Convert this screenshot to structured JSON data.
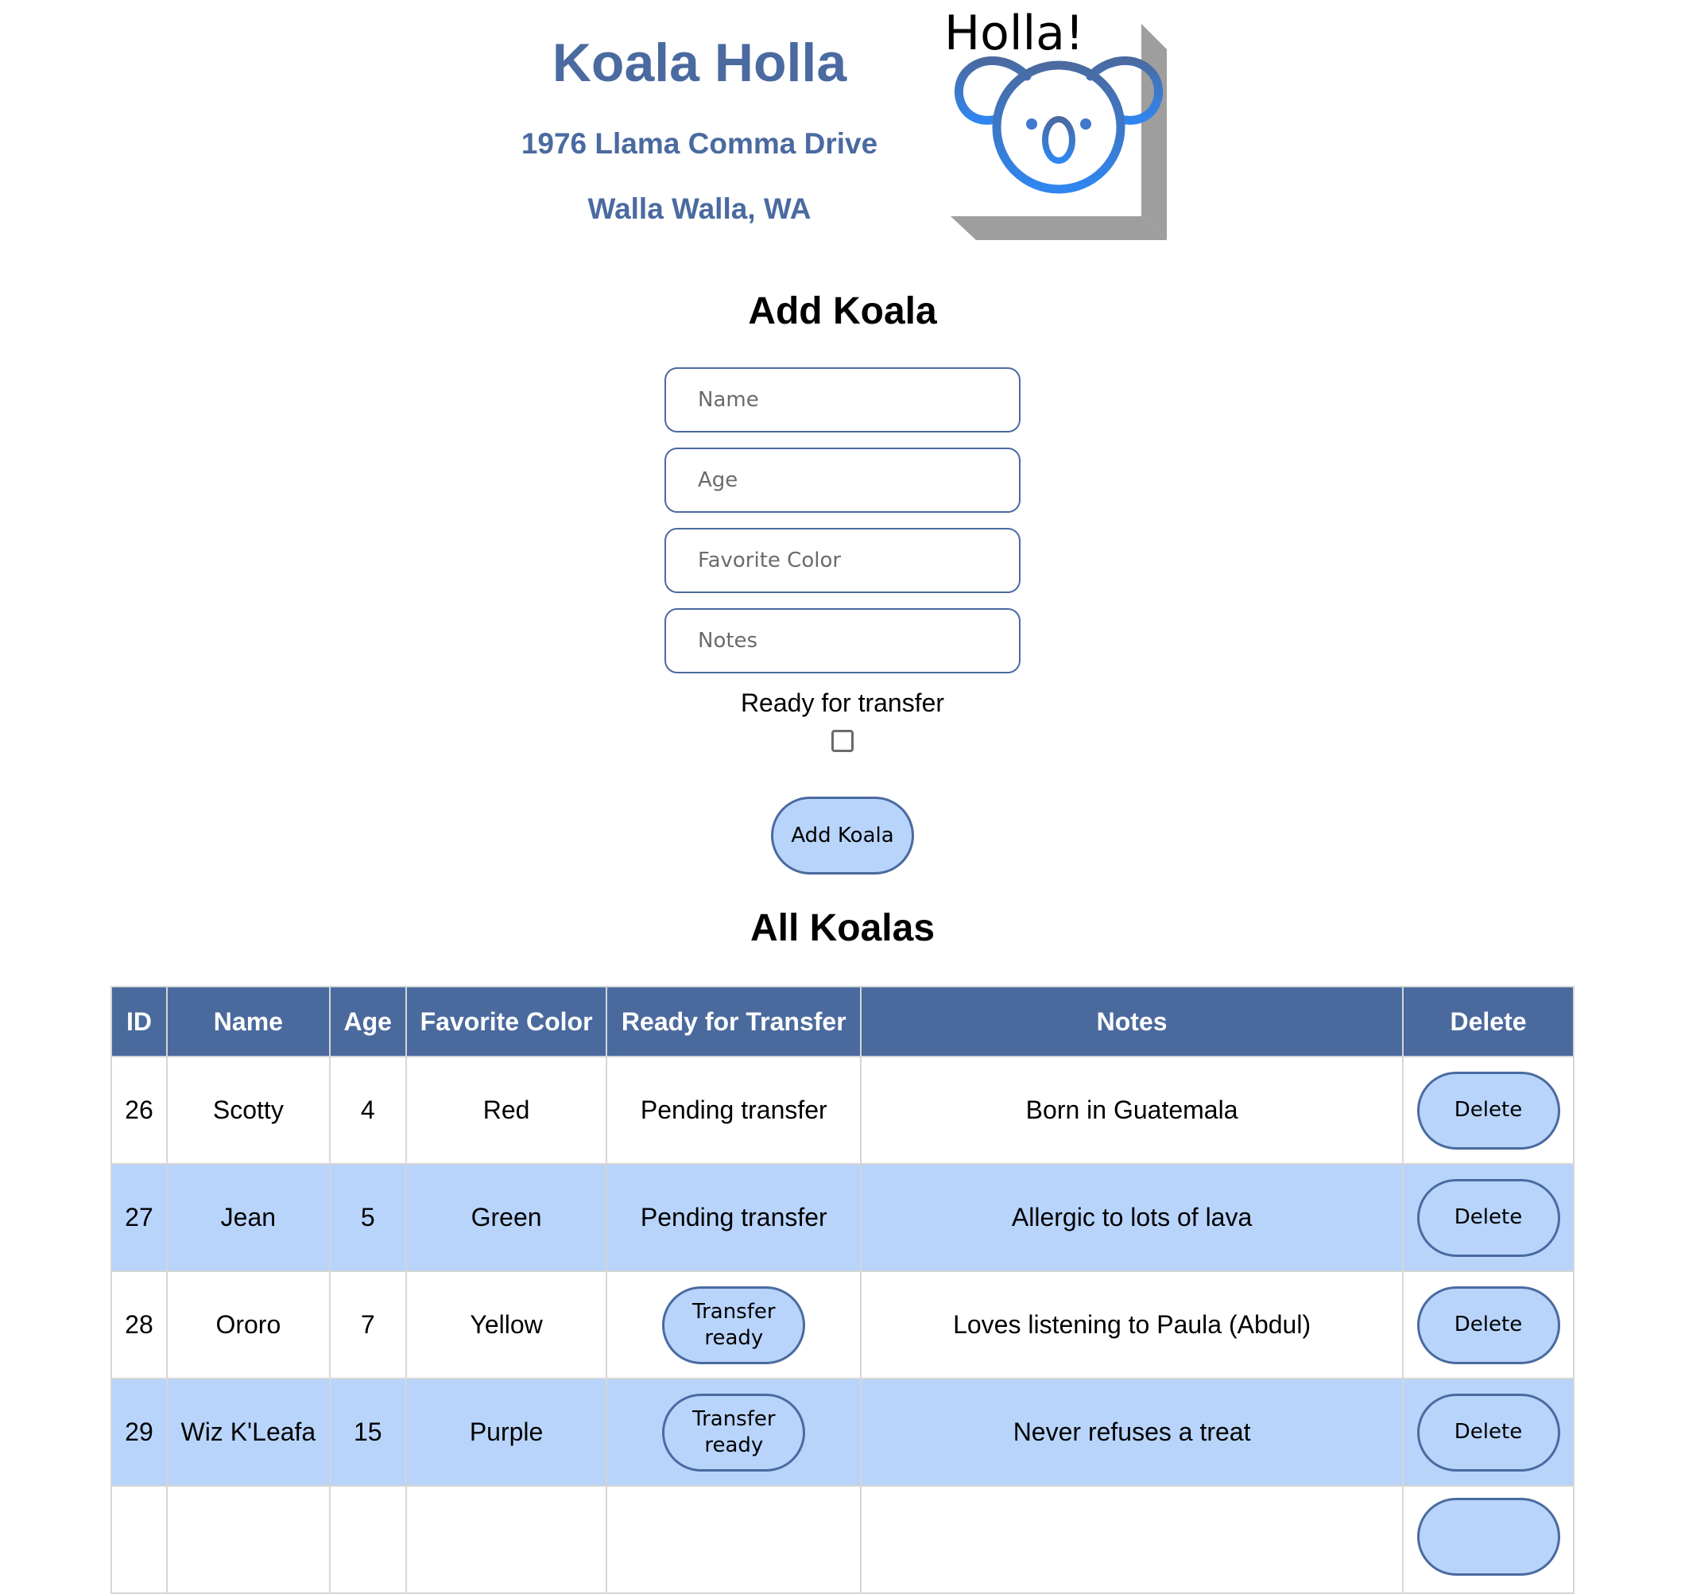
{
  "header": {
    "title": "Koala Holla",
    "address_line1": "1976 Llama Comma Drive",
    "address_line2": "Walla Walla, WA",
    "logo_text": "Holla!"
  },
  "add_form": {
    "title": "Add Koala",
    "name_placeholder": "Name",
    "age_placeholder": "Age",
    "color_placeholder": "Favorite Color",
    "notes_placeholder": "Notes",
    "ready_label": "Ready for transfer",
    "ready_checked": false,
    "submit_label": "Add Koala"
  },
  "table": {
    "title": "All Koalas",
    "columns": [
      "ID",
      "Name",
      "Age",
      "Favorite Color",
      "Ready for Transfer",
      "Notes",
      "Delete"
    ],
    "rows": [
      {
        "id": "26",
        "name": "Scotty",
        "age": "4",
        "color": "Red",
        "transfer": "Pending transfer",
        "transfer_is_button": false,
        "notes": "Born in Guatemala",
        "delete_label": "Delete"
      },
      {
        "id": "27",
        "name": "Jean",
        "age": "5",
        "color": "Green",
        "transfer": "Pending transfer",
        "transfer_is_button": false,
        "notes": "Allergic to lots of lava",
        "delete_label": "Delete"
      },
      {
        "id": "28",
        "name": "Ororo",
        "age": "7",
        "color": "Yellow",
        "transfer": "Transfer ready",
        "transfer_is_button": true,
        "notes": "Loves listening to Paula (Abdul)",
        "delete_label": "Delete"
      },
      {
        "id": "29",
        "name": "Wiz K'Leafa",
        "age": "15",
        "color": "Purple",
        "transfer": "Transfer ready",
        "transfer_is_button": true,
        "notes": "Never refuses a treat",
        "delete_label": "Delete"
      }
    ]
  },
  "colors": {
    "brand_blue": "#4a6aa0",
    "header_bg": "#4a6a9e",
    "row_highlight": "#b8d4fb",
    "logo_blue": "#2f86f0",
    "logo_shadow": "#9e9e9e"
  },
  "icons": {
    "logo": "koala-face-icon"
  }
}
